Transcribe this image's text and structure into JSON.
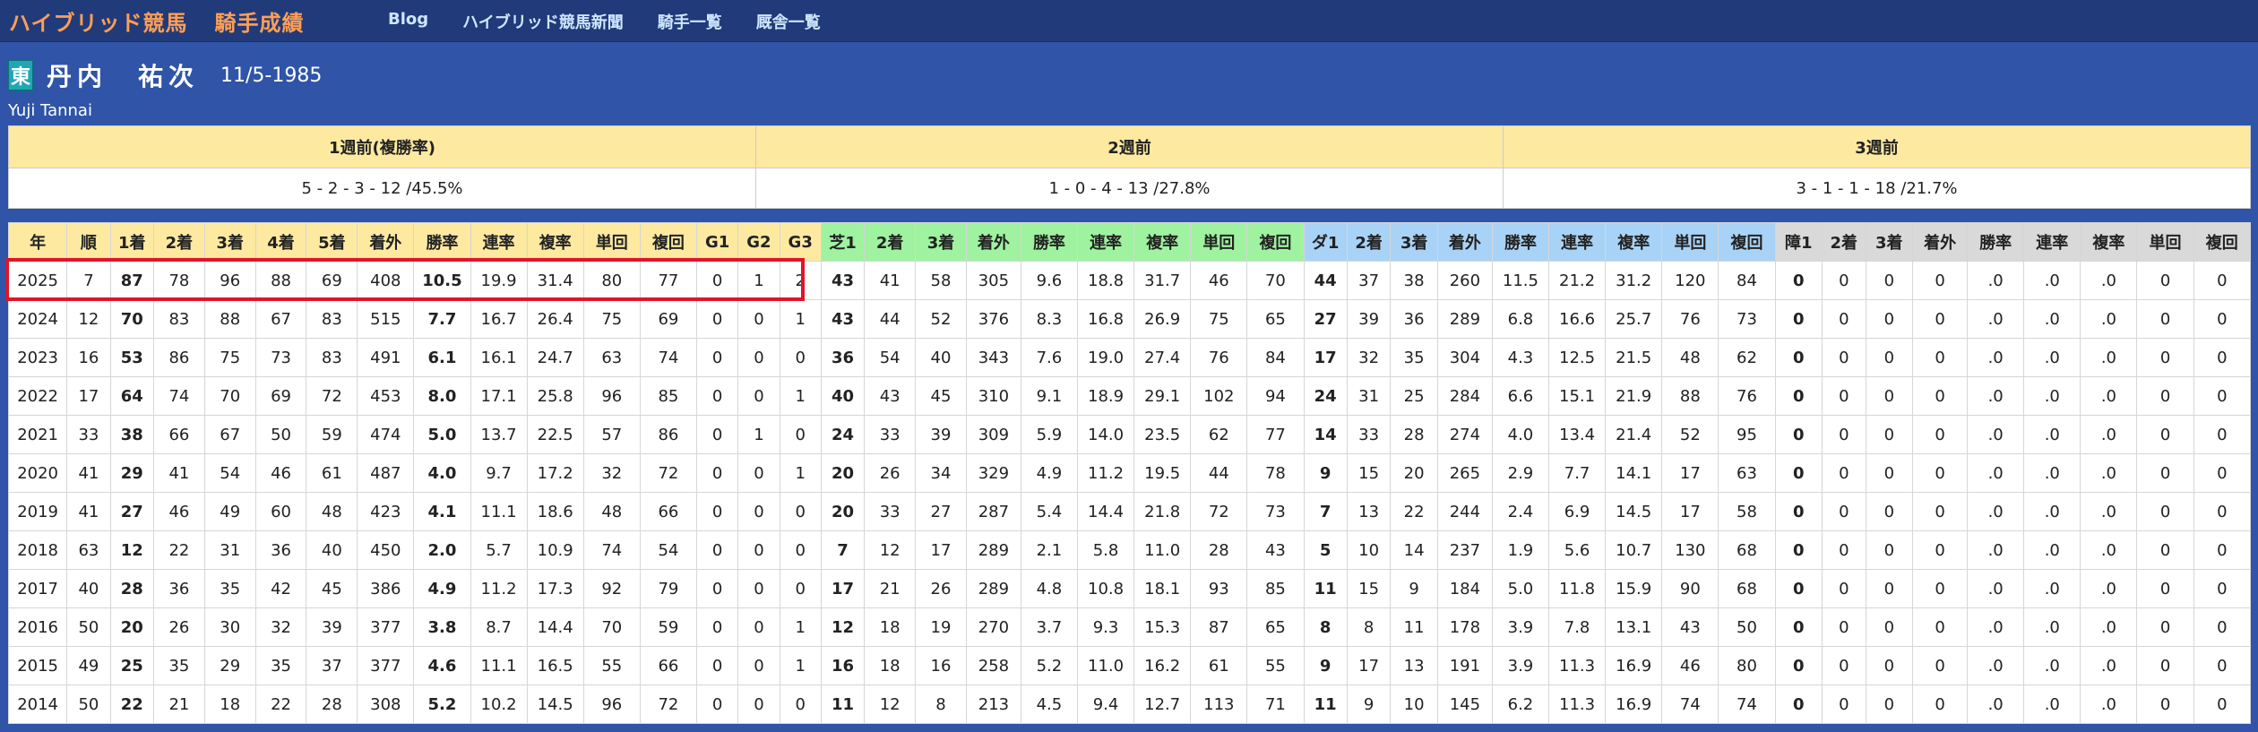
{
  "site": {
    "brand": "ハイブリッド競馬",
    "section": "騎手成績"
  },
  "nav": [
    "Blog",
    "ハイブリッド競馬新聞",
    "騎手一覧",
    "厩舎一覧"
  ],
  "jockey": {
    "badge": "東",
    "name": "丹内　祐次",
    "birthdate": "11/5-1985",
    "roman": "Yuji Tannai"
  },
  "weeks": {
    "headers": [
      "1週前(複勝率)",
      "2週前",
      "3週前"
    ],
    "values": [
      "5 - 2 - 3 - 12 /45.5%",
      "1 - 0 - 4 - 13 /27.8%",
      "3 - 1 - 1 - 18 /21.7%"
    ]
  },
  "stats": {
    "headers": [
      "年",
      "順",
      "1着",
      "2着",
      "3着",
      "4着",
      "5着",
      "着外",
      "勝率",
      "連率",
      "複率",
      "単回",
      "複回",
      "G1",
      "G2",
      "G3",
      "芝1",
      "2着",
      "3着",
      "着外",
      "勝率",
      "連率",
      "複率",
      "単回",
      "複回",
      "ダ1",
      "2着",
      "3着",
      "着外",
      "勝率",
      "連率",
      "複率",
      "単回",
      "複回",
      "障1",
      "2着",
      "3着",
      "着外",
      "勝率",
      "連率",
      "複率",
      "単回",
      "複回"
    ],
    "header_groups": [
      0,
      0,
      0,
      0,
      0,
      0,
      0,
      0,
      0,
      0,
      0,
      0,
      0,
      0,
      0,
      0,
      1,
      1,
      1,
      1,
      1,
      1,
      1,
      1,
      1,
      2,
      2,
      2,
      2,
      2,
      2,
      2,
      2,
      2,
      3,
      3,
      3,
      3,
      3,
      3,
      3,
      3,
      3
    ],
    "bold_cols": [
      2,
      8,
      16,
      25,
      34
    ],
    "rows": [
      [
        "2025",
        "7",
        "87",
        "78",
        "96",
        "88",
        "69",
        "408",
        "10.5",
        "19.9",
        "31.4",
        "80",
        "77",
        "0",
        "1",
        "2",
        "43",
        "41",
        "58",
        "305",
        "9.6",
        "18.8",
        "31.7",
        "46",
        "70",
        "44",
        "37",
        "38",
        "260",
        "11.5",
        "21.2",
        "31.2",
        "120",
        "84",
        "0",
        "0",
        "0",
        "0",
        ".0",
        ".0",
        ".0",
        "0",
        "0"
      ],
      [
        "2024",
        "12",
        "70",
        "83",
        "88",
        "67",
        "83",
        "515",
        "7.7",
        "16.7",
        "26.4",
        "75",
        "69",
        "0",
        "0",
        "1",
        "43",
        "44",
        "52",
        "376",
        "8.3",
        "16.8",
        "26.9",
        "75",
        "65",
        "27",
        "39",
        "36",
        "289",
        "6.8",
        "16.6",
        "25.7",
        "76",
        "73",
        "0",
        "0",
        "0",
        "0",
        ".0",
        ".0",
        ".0",
        "0",
        "0"
      ],
      [
        "2023",
        "16",
        "53",
        "86",
        "75",
        "73",
        "83",
        "491",
        "6.1",
        "16.1",
        "24.7",
        "63",
        "74",
        "0",
        "0",
        "0",
        "36",
        "54",
        "40",
        "343",
        "7.6",
        "19.0",
        "27.4",
        "76",
        "84",
        "17",
        "32",
        "35",
        "304",
        "4.3",
        "12.5",
        "21.5",
        "48",
        "62",
        "0",
        "0",
        "0",
        "0",
        ".0",
        ".0",
        ".0",
        "0",
        "0"
      ],
      [
        "2022",
        "17",
        "64",
        "74",
        "70",
        "69",
        "72",
        "453",
        "8.0",
        "17.1",
        "25.8",
        "96",
        "85",
        "0",
        "0",
        "1",
        "40",
        "43",
        "45",
        "310",
        "9.1",
        "18.9",
        "29.1",
        "102",
        "94",
        "24",
        "31",
        "25",
        "284",
        "6.6",
        "15.1",
        "21.9",
        "88",
        "76",
        "0",
        "0",
        "0",
        "0",
        ".0",
        ".0",
        ".0",
        "0",
        "0"
      ],
      [
        "2021",
        "33",
        "38",
        "66",
        "67",
        "50",
        "59",
        "474",
        "5.0",
        "13.7",
        "22.5",
        "57",
        "86",
        "0",
        "1",
        "0",
        "24",
        "33",
        "39",
        "309",
        "5.9",
        "14.0",
        "23.5",
        "62",
        "77",
        "14",
        "33",
        "28",
        "274",
        "4.0",
        "13.4",
        "21.4",
        "52",
        "95",
        "0",
        "0",
        "0",
        "0",
        ".0",
        ".0",
        ".0",
        "0",
        "0"
      ],
      [
        "2020",
        "41",
        "29",
        "41",
        "54",
        "46",
        "61",
        "487",
        "4.0",
        "9.7",
        "17.2",
        "32",
        "72",
        "0",
        "0",
        "1",
        "20",
        "26",
        "34",
        "329",
        "4.9",
        "11.2",
        "19.5",
        "44",
        "78",
        "9",
        "15",
        "20",
        "265",
        "2.9",
        "7.7",
        "14.1",
        "17",
        "63",
        "0",
        "0",
        "0",
        "0",
        ".0",
        ".0",
        ".0",
        "0",
        "0"
      ],
      [
        "2019",
        "41",
        "27",
        "46",
        "49",
        "60",
        "48",
        "423",
        "4.1",
        "11.1",
        "18.6",
        "48",
        "66",
        "0",
        "0",
        "0",
        "20",
        "33",
        "27",
        "287",
        "5.4",
        "14.4",
        "21.8",
        "72",
        "73",
        "7",
        "13",
        "22",
        "244",
        "2.4",
        "6.9",
        "14.5",
        "17",
        "58",
        "0",
        "0",
        "0",
        "0",
        ".0",
        ".0",
        ".0",
        "0",
        "0"
      ],
      [
        "2018",
        "63",
        "12",
        "22",
        "31",
        "36",
        "40",
        "450",
        "2.0",
        "5.7",
        "10.9",
        "74",
        "54",
        "0",
        "0",
        "0",
        "7",
        "12",
        "17",
        "289",
        "2.1",
        "5.8",
        "11.0",
        "28",
        "43",
        "5",
        "10",
        "14",
        "237",
        "1.9",
        "5.6",
        "10.7",
        "130",
        "68",
        "0",
        "0",
        "0",
        "0",
        ".0",
        ".0",
        ".0",
        "0",
        "0"
      ],
      [
        "2017",
        "40",
        "28",
        "36",
        "35",
        "42",
        "45",
        "386",
        "4.9",
        "11.2",
        "17.3",
        "92",
        "79",
        "0",
        "0",
        "0",
        "17",
        "21",
        "26",
        "289",
        "4.8",
        "10.8",
        "18.1",
        "93",
        "85",
        "11",
        "15",
        "9",
        "184",
        "5.0",
        "11.8",
        "15.9",
        "90",
        "68",
        "0",
        "0",
        "0",
        "0",
        ".0",
        ".0",
        ".0",
        "0",
        "0"
      ],
      [
        "2016",
        "50",
        "20",
        "26",
        "30",
        "32",
        "39",
        "377",
        "3.8",
        "8.7",
        "14.4",
        "70",
        "59",
        "0",
        "0",
        "1",
        "12",
        "18",
        "19",
        "270",
        "3.7",
        "9.3",
        "15.3",
        "87",
        "65",
        "8",
        "8",
        "11",
        "178",
        "3.9",
        "7.8",
        "13.1",
        "43",
        "50",
        "0",
        "0",
        "0",
        "0",
        ".0",
        ".0",
        ".0",
        "0",
        "0"
      ],
      [
        "2015",
        "49",
        "25",
        "35",
        "29",
        "35",
        "37",
        "377",
        "4.6",
        "11.1",
        "16.5",
        "55",
        "66",
        "0",
        "0",
        "1",
        "16",
        "18",
        "16",
        "258",
        "5.2",
        "11.0",
        "16.2",
        "61",
        "55",
        "9",
        "17",
        "13",
        "191",
        "3.9",
        "11.3",
        "16.9",
        "46",
        "80",
        "0",
        "0",
        "0",
        "0",
        ".0",
        ".0",
        ".0",
        "0",
        "0"
      ],
      [
        "2014",
        "50",
        "22",
        "21",
        "18",
        "22",
        "28",
        "308",
        "5.2",
        "10.2",
        "14.5",
        "96",
        "72",
        "0",
        "0",
        "0",
        "11",
        "12",
        "8",
        "213",
        "4.5",
        "9.4",
        "12.7",
        "113",
        "71",
        "11",
        "9",
        "10",
        "145",
        "6.2",
        "11.3",
        "16.9",
        "74",
        "74",
        "0",
        "0",
        "0",
        "0",
        ".0",
        ".0",
        ".0",
        "0",
        "0"
      ]
    ]
  },
  "colors": {
    "background": "#2f54a8",
    "topbar": "#213a7a",
    "brand": "#ff9f55",
    "nav_link": "#cfe6ff",
    "header_overall": "#fde9a0",
    "header_turf": "#9ff2a0",
    "header_dirt": "#a9d3f6",
    "header_jump": "#d9d9d9",
    "highlight_box": "#e0142a"
  }
}
